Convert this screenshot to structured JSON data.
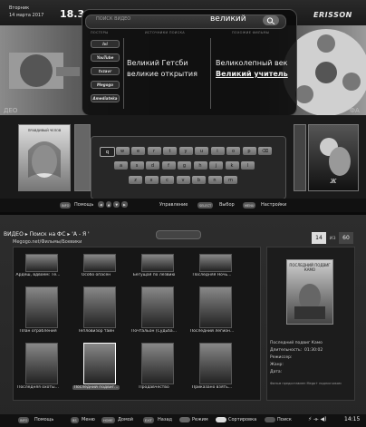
{
  "top_screen": {
    "date": {
      "line1": "Вторник",
      "line2": "14 марта 2017"
    },
    "clock": "18.3",
    "brand": "ERISSON",
    "search": {
      "label": "ПОИСК ВИДЕО",
      "value": "великий",
      "button_icon": "search-icon"
    },
    "column_headers": [
      "ПОСТЕРЫ",
      "ИСТОЧНИКИ ПОИСКА",
      "ПОХОЖИЕ ФИЛЬМЫ"
    ],
    "providers": [
      "Ivi",
      "YouTube",
      "tvzavr",
      "Megogo",
      "Amediateka"
    ],
    "results_left": [
      "Великий Гетсби",
      "великие открытия"
    ],
    "results_right": [
      "Великолепный век",
      "Великий учитель"
    ],
    "side_labels": {
      "left": "ДЕО",
      "right": "ФА"
    },
    "keyboard": {
      "rows": [
        [
          "q",
          "w",
          "e",
          "r",
          "t",
          "y",
          "u",
          "i",
          "o",
          "p",
          "⌫"
        ],
        [
          "a",
          "s",
          "d",
          "f",
          "g",
          "h",
          "j",
          "k",
          "l"
        ],
        [
          "z",
          "x",
          "c",
          "v",
          "b",
          "n",
          "m"
        ]
      ],
      "selected_key": "q"
    },
    "bottom_bar": {
      "info_btn": "INFO",
      "help": "Помощь",
      "nav_label": "Управление",
      "select_btn": "SELECT",
      "select": "Выбор",
      "menu_btn": "MENU",
      "settings": "Настройки"
    },
    "poster_left_title": "ПРАВДИВЫЙ ЧЕЛОВ"
  },
  "bottom_screen": {
    "breadcrumb": "ВИДЕО ▸ Поиск на ФС ▸ 'А - Я '",
    "search_placeholder": "",
    "path": "Megogo.net/Фильмы/Боевики",
    "page": {
      "current": "14",
      "of": "из",
      "total": "60"
    },
    "grid": [
      [
        "Ардеш, вдвоём: Те...",
        "Особо опасен",
        "Бегущая по лезвию",
        "Последняя Ночь..."
      ],
      [
        "План ограбления",
        "Тепловизор тайн",
        "Почтальон (Судьба...",
        "Последний легион..."
      ],
      [
        "Последняя охоты...",
        "Последний подвиг...",
        "Продавчество",
        "Приказано взять..."
      ]
    ],
    "selected_index": [
      2,
      1
    ],
    "info": {
      "poster_title": "ПОСЛЕДНИЙ ПОДВИГ КАМО",
      "title_label": "Последний подвиг Камо",
      "duration_label": "Длительность:",
      "duration_value": "01:30:02",
      "fields": [
        "Режиссер:",
        "Жанр:",
        "Дата:"
      ],
      "note": "Фильм предоставлен Mega+ подписчикам"
    },
    "bottom_bar": {
      "info_btn": "INFO",
      "help": "Помощь",
      "bs_btn": "BS",
      "menu": "Меню",
      "home_btn": "HOME",
      "home": "Домой",
      "exit_btn": "EXIT",
      "back": "Назад",
      "mode": "Режим",
      "sort": "Сортировка",
      "search": "Поиск",
      "clock": "14:15"
    }
  }
}
